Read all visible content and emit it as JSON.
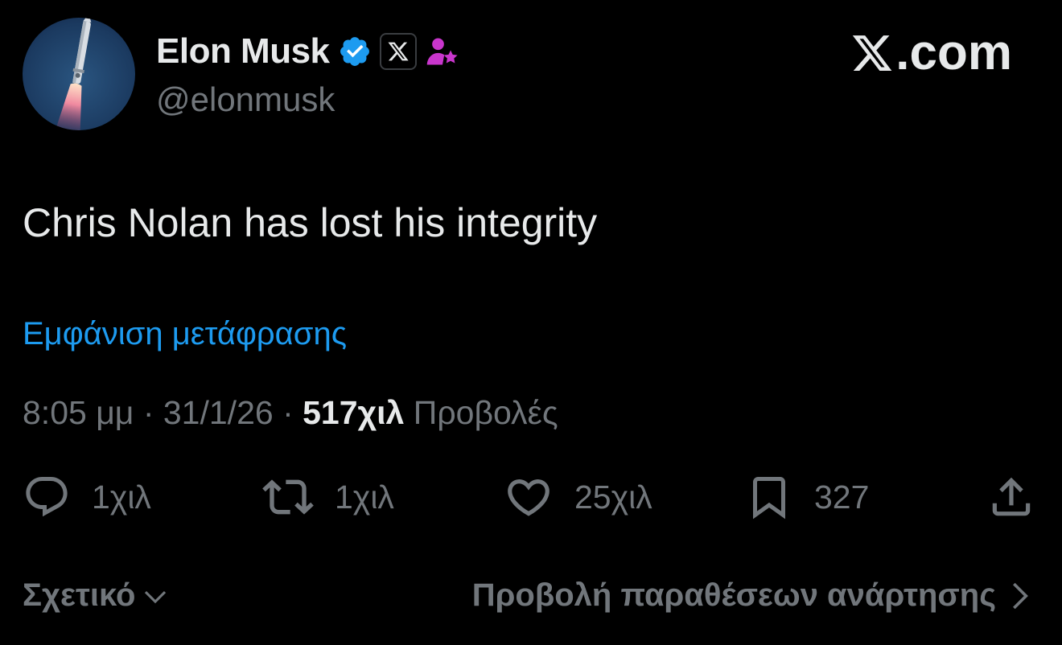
{
  "author": {
    "display_name": "Elon Musk",
    "handle": "@elonmusk",
    "avatar_icon": "rocket-launch-avatar",
    "badges": [
      "verified-badge-icon",
      "x-affiliate-badge-icon",
      "subscriber-star-badge-icon"
    ]
  },
  "site_mark": {
    "text": ".com",
    "icon": "x-logo-icon"
  },
  "post": {
    "text": "Chris Nolan has lost his integrity",
    "translate_link": "Εμφάνιση μετάφρασης"
  },
  "meta": {
    "time": "8:05 μμ",
    "separator1": " · ",
    "date": "31/1/26",
    "separator2": " · ",
    "views_count": "517χιλ",
    "views_label": " Προβολές"
  },
  "actions": {
    "reply": {
      "icon": "reply-icon",
      "count": "1χιλ"
    },
    "repost": {
      "icon": "repost-icon",
      "count": "1χιλ"
    },
    "like": {
      "icon": "heart-icon",
      "count": "25χιλ"
    },
    "bookmark": {
      "icon": "bookmark-icon",
      "count": "327"
    },
    "share": {
      "icon": "share-icon"
    }
  },
  "footer": {
    "related_label": "Σχετικό",
    "related_icon": "chevron-down-icon",
    "quotes_label": "Προβολή παραθέσεων ανάρτησης",
    "quotes_icon": "chevron-right-icon"
  },
  "colors": {
    "background": "#000000",
    "primary_text": "#e7e9ea",
    "secondary_text": "#71767b",
    "link": "#1d9bf0",
    "verified": "#1d9bf0",
    "subscriber_badge": "#c936cc"
  }
}
